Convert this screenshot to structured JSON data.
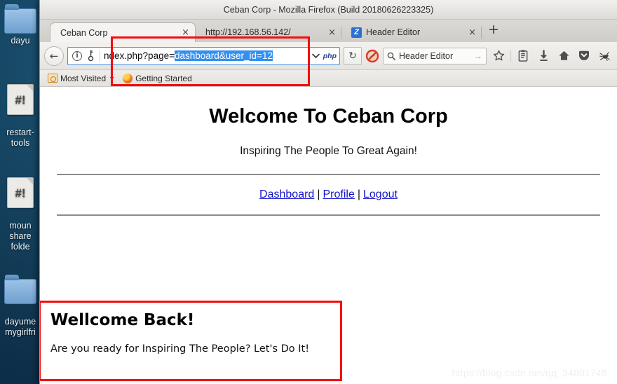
{
  "desktop": {
    "icons": [
      {
        "label": "dayu",
        "type": "folder"
      },
      {
        "label": "restart-\ntools",
        "type": "script",
        "glyph": "#!"
      },
      {
        "label": "moun\nshare\nfolde",
        "type": "script",
        "glyph": "#!"
      },
      {
        "label": "dayume\nmygirlfri",
        "type": "folder"
      }
    ]
  },
  "window": {
    "title": "Ceban Corp - Mozilla Firefox (Build 20180626223325)"
  },
  "tabs": {
    "items": [
      {
        "label": "Ceban Corp",
        "close": "×",
        "active": true
      },
      {
        "label": "http://192.168.56.142/",
        "close": "×",
        "active": false
      },
      {
        "label": "Header Editor",
        "close": "×",
        "active": false,
        "favicon": "Z"
      }
    ],
    "new_tab_label": "+"
  },
  "navbar": {
    "back_label": "←",
    "identity_info": "i",
    "identity_key": "⚷",
    "url_prefix": "ndex.php?page=",
    "url_selected": "dashboard&user_id=12",
    "url_chevron": "⌄",
    "url_tag": "php",
    "reload_label": "↻",
    "blocked_icon": "blocked-popup-icon",
    "search_value": "Header Editor",
    "search_placeholder": "Search",
    "search_go": "→",
    "icons": [
      {
        "name": "bookmark-star-icon",
        "glyph": "☆"
      },
      {
        "name": "library-icon",
        "glyph": "Ὄb"
      },
      {
        "name": "downloads-icon",
        "glyph": "↓"
      },
      {
        "name": "home-icon",
        "glyph": "⌂"
      },
      {
        "name": "pocket-icon",
        "glyph": "♥"
      },
      {
        "name": "extension-spider-icon",
        "glyph": "❦"
      }
    ]
  },
  "bookmarks": {
    "items": [
      {
        "label": "Most Visited",
        "icon": "most-visited-icon",
        "has_chevron": true
      },
      {
        "label": "Getting Started",
        "icon": "firefox-icon",
        "has_chevron": false
      }
    ]
  },
  "page": {
    "heading": "Welcome To Ceban Corp",
    "tagline": "Inspiring The People To Great Again!",
    "nav": {
      "dashboard": "Dashboard",
      "profile": "Profile",
      "logout": "Logout",
      "separator": "|"
    },
    "welcome": {
      "title": "Wellcome Back!",
      "text": "Are you ready for Inspiring The People? Let's Do It!"
    }
  },
  "watermark": "https://blog.csdn.net/qq_34801745",
  "colors": {
    "annotation_red": "#f50c0c",
    "selection_blue": "#3390ee",
    "link_blue": "#1414cc"
  }
}
